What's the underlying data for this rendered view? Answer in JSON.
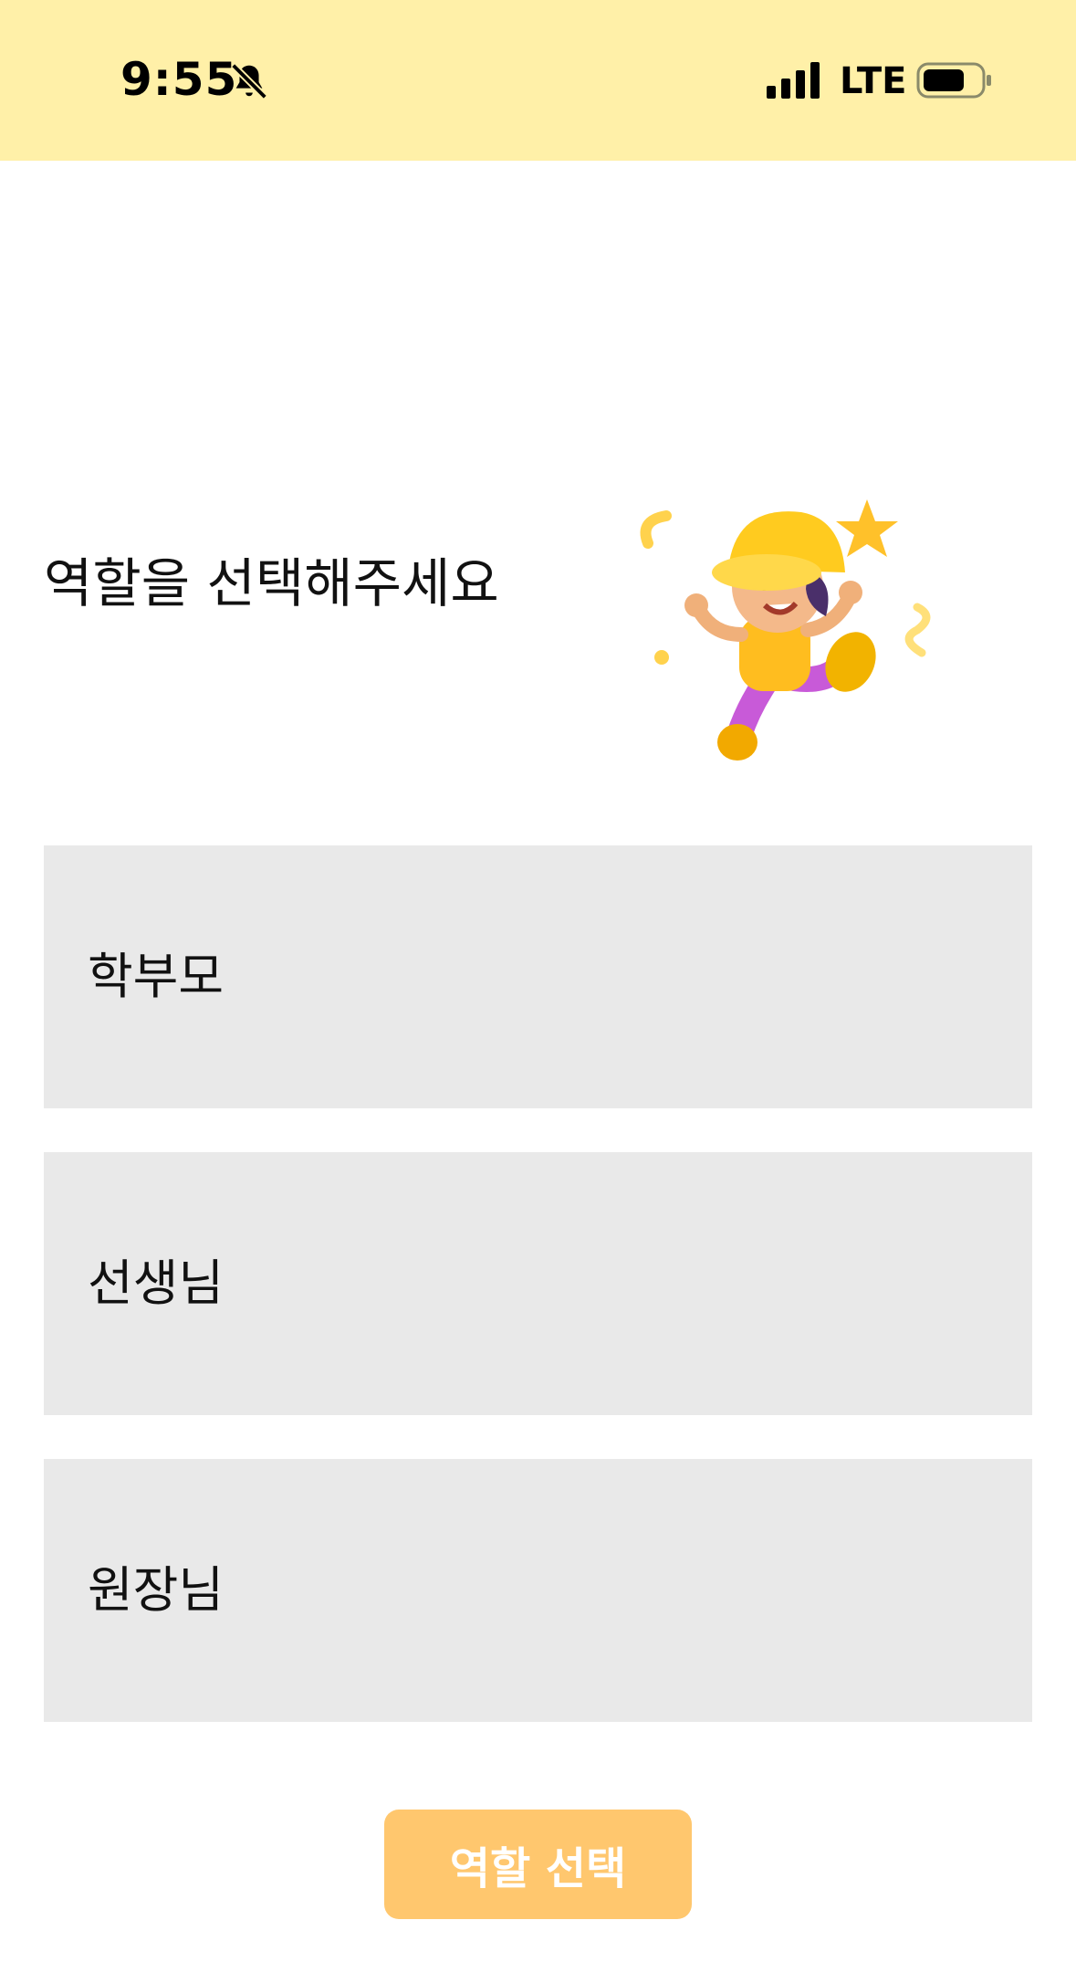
{
  "status_bar": {
    "time": "9:55",
    "network": "LTE",
    "background_color": "#fff0a8",
    "icons": [
      "bell-slash-icon",
      "signal-icon",
      "battery-icon"
    ]
  },
  "main": {
    "title": "역할을 선택해주세요",
    "mascot": "mascot-illustration",
    "roles": [
      {
        "label": "학부모"
      },
      {
        "label": "선생님"
      },
      {
        "label": "원장님"
      }
    ],
    "option_color": "#e9e9e9"
  },
  "footer": {
    "select_button_label": "역할 선택",
    "button_color": "#ffc76e"
  }
}
